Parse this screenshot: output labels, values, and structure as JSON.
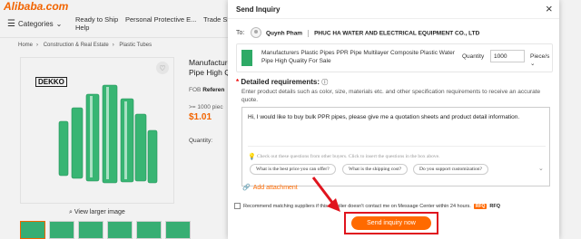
{
  "site": {
    "logo": "Alibaba.com",
    "categories_label": "Categories",
    "nav": [
      "Ready to Ship Help",
      "Personal Protective E...",
      "Trade Sh"
    ]
  },
  "breadcrumb": [
    "Home",
    "Construction & Real Estate",
    "Plastic Tubes"
  ],
  "product_page": {
    "brand": "DEKKO",
    "title": "Manufacture Pipe High Q",
    "fob_label": "FOB",
    "fob_value": "Referen",
    "moq": ">= 1000 piec",
    "price": "$1.01",
    "quantity_label": "Quantity:",
    "view_larger": "View larger image"
  },
  "modal": {
    "title": "Send Inquiry",
    "close": "×",
    "to_label": "To:",
    "contact_name": "Quynh Pham",
    "company": "PHUC HA WATER AND ELECTRICAL EQUIPMENT CO., LTD",
    "product_name": "Manufacturers Plastic Pipes PPR Pipe Multilayer Composite Plastic Water Pipe High Quality For Sale",
    "quantity_label": "Quantity",
    "quantity_value": "1000",
    "unit": "Piece/s",
    "requirements_label": "Detailed requirements:",
    "requirements_hint": "Enter product details such as color, size, materials etc. and other specification requirements to receive an accurate quote.",
    "message": "Hi, I would like to buy bulk PPR pipes, please give me a quotation sheets and product detail information.",
    "suggest_hint": "Check out these questions from other buyers. Click to insert the questions in the box above.",
    "questions": [
      "What is the best price you can offer?",
      "What is the shipping cost?",
      "Do you support customization?"
    ],
    "attachment_label": "Add attachment",
    "recommend_text": "Recommend matching suppliers if this supplier doesn't contact me on Message Center within 24 hours.",
    "rfq_badge": "RFQ",
    "rfq_label": "RFQ",
    "send_button": "Send inquiry now"
  },
  "colors": {
    "accent": "#ff6a00",
    "highlight": "#e0141e"
  }
}
